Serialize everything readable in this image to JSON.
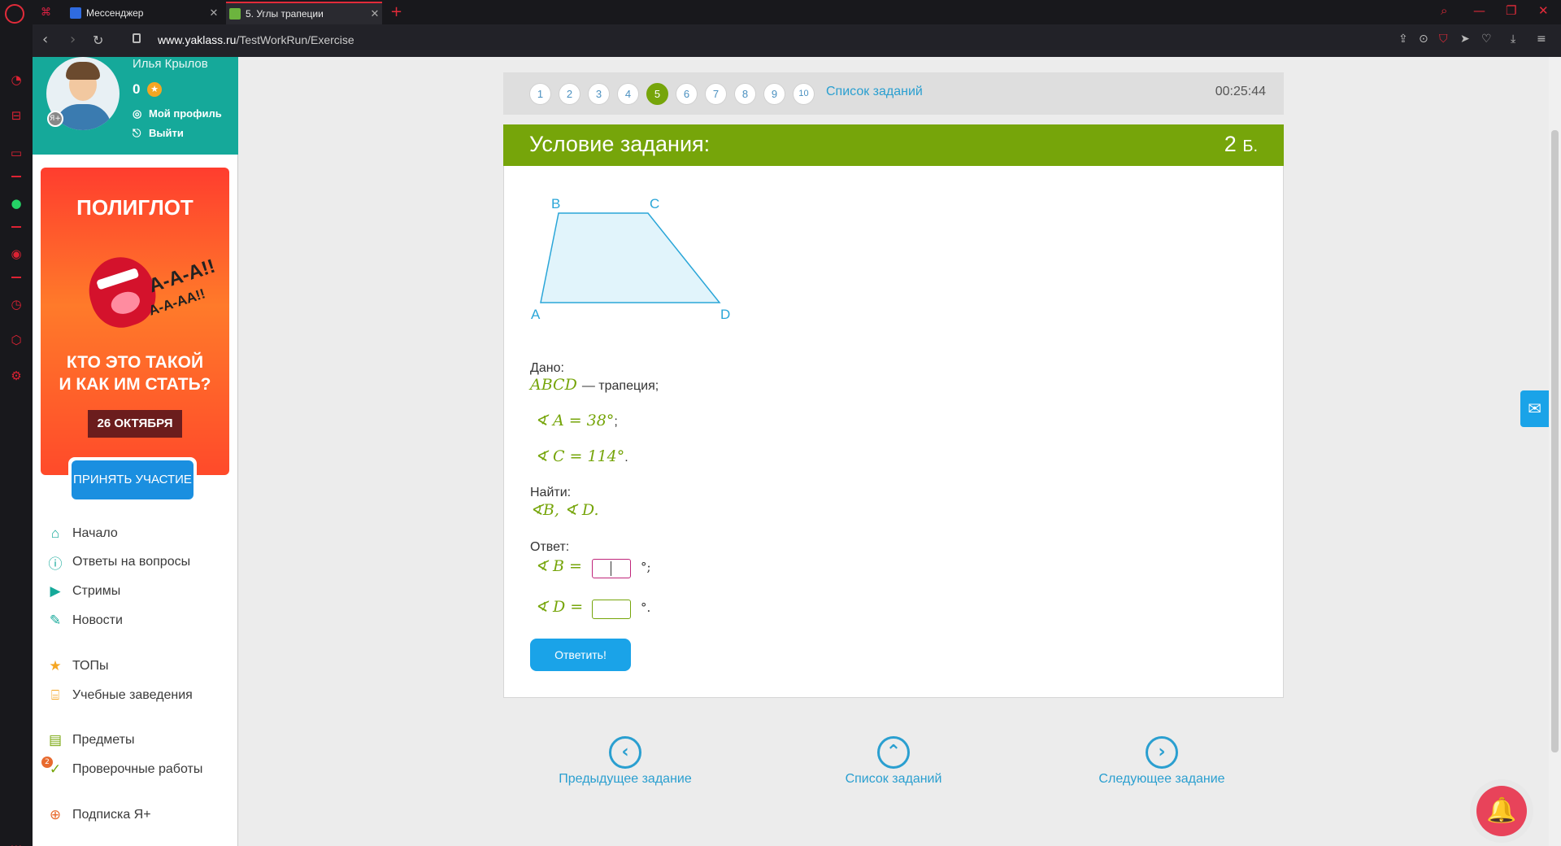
{
  "browser": {
    "tabs": [
      {
        "title": "Мессенджер"
      },
      {
        "title": "5. Углы трапеции"
      }
    ],
    "url_host": "www.yaklass.ru",
    "url_path": "/TestWorkRun/Exercise"
  },
  "sidebar": {
    "user_name": "Илья Крылов",
    "points": "0",
    "profile_link": "Мой профиль",
    "logout_link": "Выйти",
    "ad": {
      "title": "ПОЛИГЛОТ",
      "scream_1": "А-А-А!!",
      "scream_2": "А-А-АА!!",
      "text_line1": "КТО ЭТО ТАКОЙ",
      "text_line2": "И КАК ИМ СТАТЬ?",
      "date": "26 ОКТЯБРЯ",
      "button": "ПРИНЯТЬ УЧАСТИЕ"
    },
    "nav": [
      {
        "label": "Начало",
        "icon": "home-icon"
      },
      {
        "label": "Ответы на вопросы",
        "icon": "question-icon"
      },
      {
        "label": "Стримы",
        "icon": "play-icon"
      },
      {
        "label": "Новости",
        "icon": "news-icon"
      },
      {
        "label": "ТОПы",
        "icon": "star-icon"
      },
      {
        "label": "Учебные заведения",
        "icon": "school-icon"
      },
      {
        "label": "Предметы",
        "icon": "book-icon"
      },
      {
        "label": "Проверочные работы",
        "icon": "check-icon",
        "badge": "2"
      },
      {
        "label": "Подписка Я+",
        "icon": "ya-plus-icon"
      }
    ]
  },
  "exercise": {
    "pages": [
      "1",
      "2",
      "3",
      "4",
      "5",
      "6",
      "7",
      "8",
      "9",
      "10"
    ],
    "active_page": "5",
    "task_list_link": "Список заданий",
    "timer": "00:25:44",
    "title": "Условие задания:",
    "points_value": "2",
    "points_unit": "Б.",
    "figure_labels": {
      "a": "A",
      "b": "B",
      "c": "C",
      "d": "D"
    },
    "given_label": "Дано:",
    "given_shape": "ABCD",
    "given_shape_text": "— трапеция;",
    "given_angle_a": "∢ A = 38°",
    "given_angle_a_end": ";",
    "given_angle_c": "∢ C = 114°",
    "given_angle_c_end": ".",
    "find_label": "Найти:",
    "find_value": "∢B,  ∢ D.",
    "answer_label": "Ответ:",
    "answer_b_label": "∢ B =",
    "answer_b_end": "°;",
    "answer_d_label": "∢ D =",
    "answer_d_end": "°.",
    "submit_button": "Ответить!"
  },
  "bottom_nav": {
    "prev": "Предыдущее задание",
    "list": "Список заданий",
    "next": "Следующее задание"
  },
  "colors": {
    "accent_green": "#76a50a",
    "link_blue": "#2a9fd0",
    "teal": "#15a99a",
    "opera_red": "#e22b3a"
  }
}
